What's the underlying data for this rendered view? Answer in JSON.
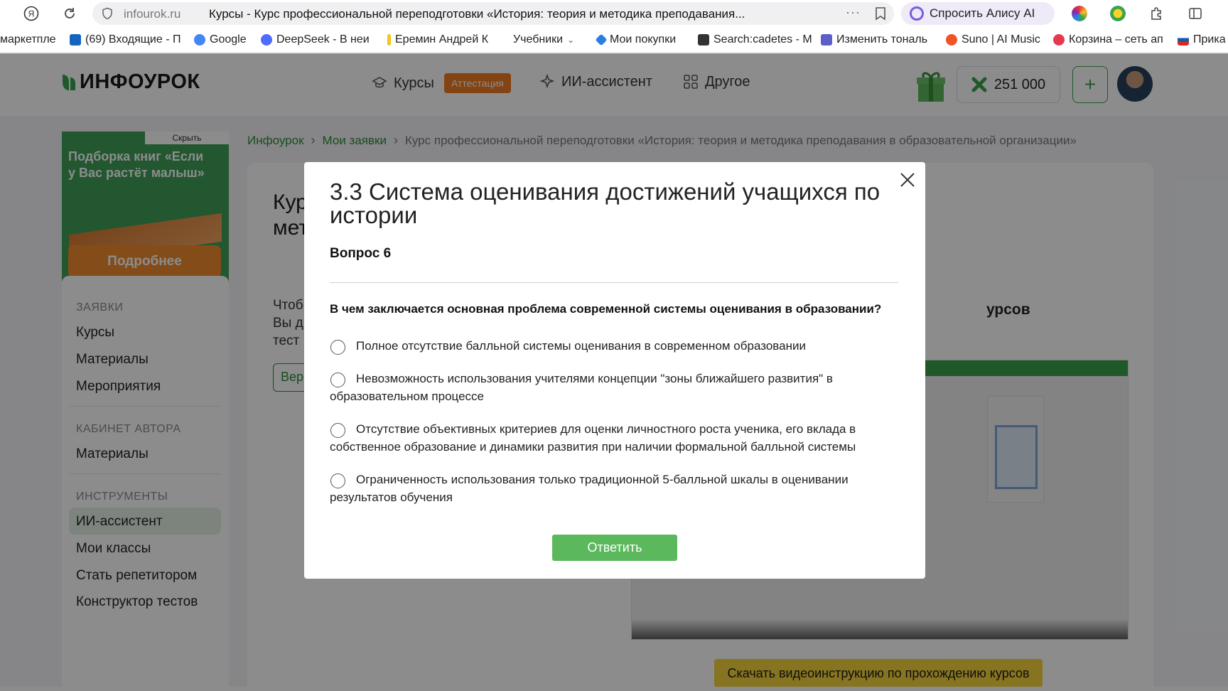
{
  "browser": {
    "domain": "infourok.ru",
    "tab_title": "Курсы - Курс профессиональной переподготовки «История: теория и методика преподавания...",
    "alice_label": "Спросить Алису AI",
    "bookmarks": [
      {
        "label": "маркетпле",
        "color": "#8a3ffc"
      },
      {
        "label": "(69) Входящие - П",
        "color": "#1565c0"
      },
      {
        "label": "Google",
        "color": "#4285f4"
      },
      {
        "label": "DeepSeek - В неи",
        "color": "#4d6bfe"
      },
      {
        "label": "Еремин Андрей К",
        "color": "#f5c518"
      },
      {
        "label": "Учебники",
        "color": "#999999"
      },
      {
        "label": "Мои покупки",
        "color": "#2a7de1"
      },
      {
        "label": "Search:cadetes - M",
        "color": "#333333"
      },
      {
        "label": "Изменить тональ",
        "color": "#5b5fc7"
      },
      {
        "label": "Suno | AI Music",
        "color": "#ee5522"
      },
      {
        "label": "Корзина – сеть ап",
        "color": "#e53950"
      },
      {
        "label": "Прика",
        "color": "#d52b1e"
      }
    ]
  },
  "header": {
    "logo_text": "ИНФОУРОК",
    "nav": {
      "courses": "Курсы",
      "attestation_badge": "Аттестация",
      "ai_assistant": "ИИ-ассистент",
      "other": "Другое"
    },
    "balance": "251 000",
    "plus": "+"
  },
  "ad": {
    "hide_label": "Скрыть",
    "text": "Подборка книг «Если у Вас растёт малыш»",
    "button": "Подробнее"
  },
  "sidebar": {
    "section_requests": "ЗАЯВКИ",
    "requests_items": [
      "Курсы",
      "Материалы",
      "Мероприятия"
    ],
    "section_author": "КАБИНЕТ АВТОРА",
    "author_items": [
      "Материалы"
    ],
    "section_tools": "ИНСТРУМЕНТЫ",
    "tools_items": [
      "ИИ-ассистент",
      "Мои классы",
      "Стать репетитором",
      "Конструктор тестов"
    ]
  },
  "breadcrumb": {
    "home": "Инфоурок",
    "my_requests": "Мои заявки",
    "current": "Курс профессиональной переподготовки «История: теория и методика преподавания в образовательной организации»"
  },
  "page": {
    "heading_line1": "Кур",
    "heading_line2": "мет",
    "para_line1": "Чтоб",
    "para_line2": "Вы д",
    "para_line3": "тест",
    "outline_button": "Вер",
    "video_title": "урсов",
    "download_button": "Скачать видеоинструкцию по прохождению курсов"
  },
  "modal": {
    "title": "3.3 Система оценивания достижений учащихся по истории",
    "question_number": "Вопрос 6",
    "question": "В чем заключается основная проблема современной системы оценивания в образовании?",
    "options": [
      {
        "first": "Полное отсутствие балльной системы оценивания в современном образовании",
        "rest": ""
      },
      {
        "first": "Невозможность использования учителями концепции \"зоны ближайшего развития\" в",
        "rest": "образовательном процессе"
      },
      {
        "first": "Отсутствие объективных критериев для оценки личностного роста ученика, его вклада в",
        "rest": "собственное образование и динамики развития при наличии формальной балльной системы"
      },
      {
        "first": "Ограниченность использования только традиционной 5-балльной шкалы в оценивании",
        "rest": "результатов обучения"
      }
    ],
    "submit": "Ответить"
  }
}
